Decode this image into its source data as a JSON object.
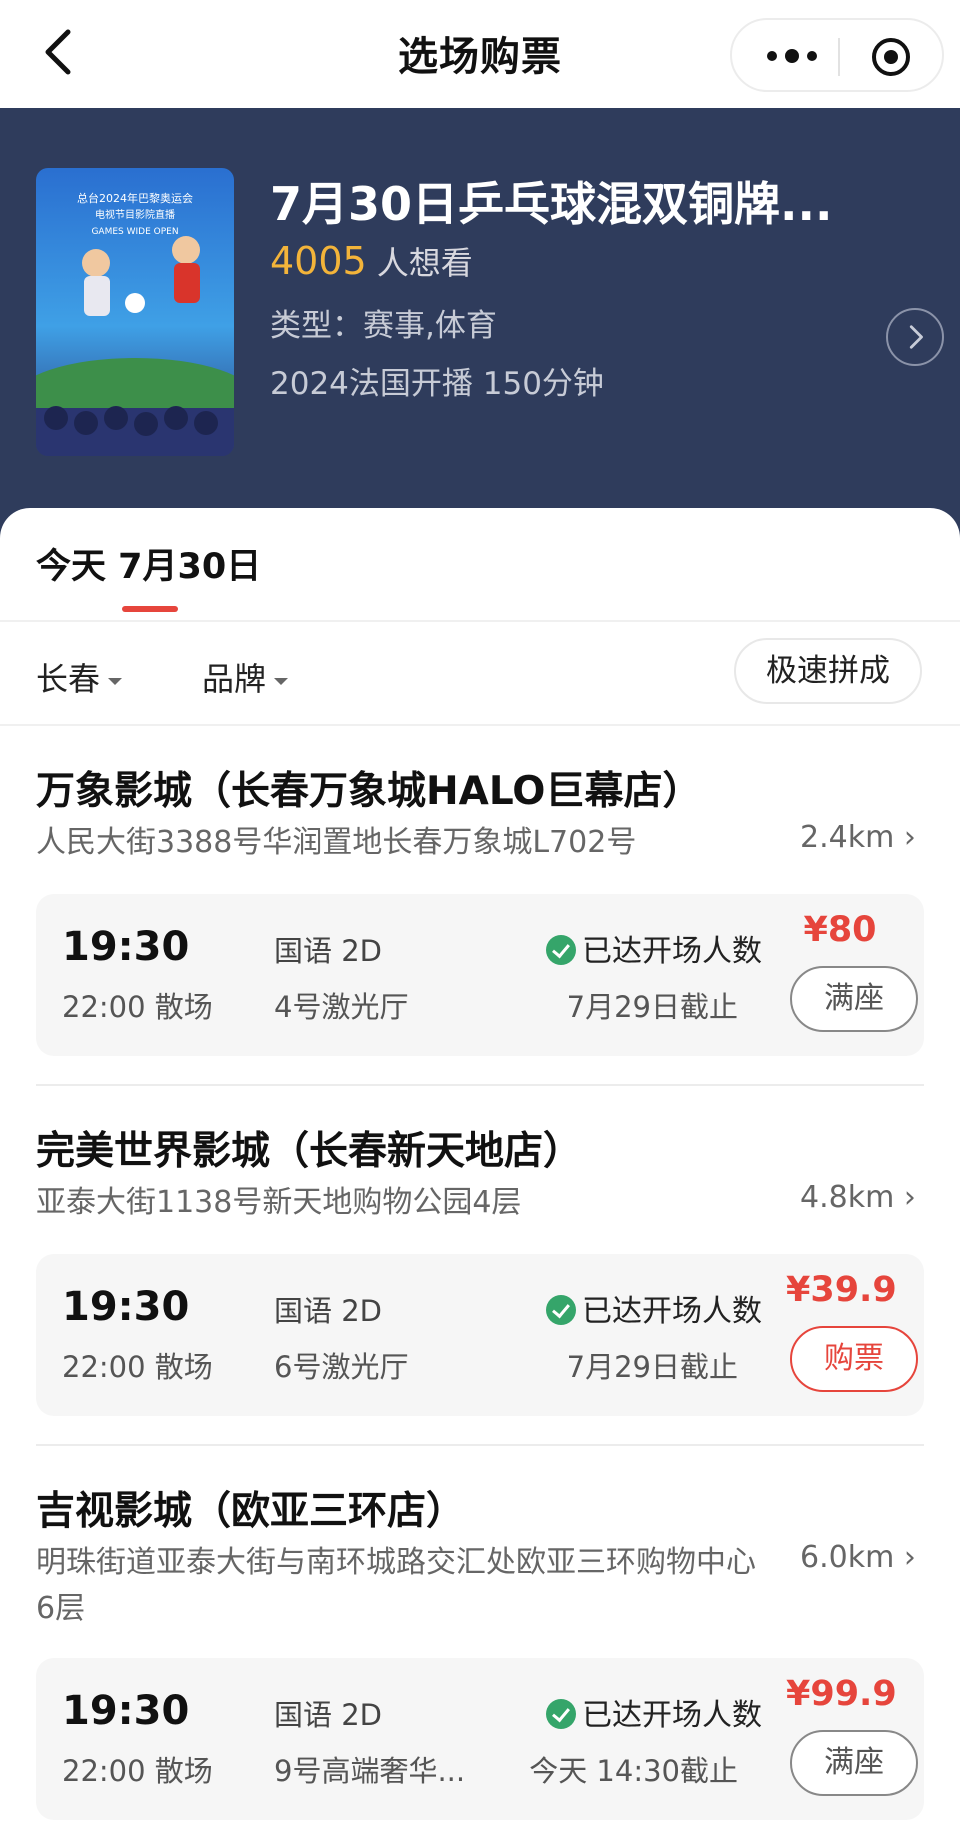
{
  "nav": {
    "title": "选场购票"
  },
  "movie": {
    "title": "7月30日乒乓球混双铜牌...",
    "want_count": "4005",
    "want_label": "人想看",
    "genre": "类型：赛事,体育",
    "meta": "2024法国开播 150分钟",
    "poster_lines": [
      "总台2024年巴黎奥运会",
      "电视节目影院直播",
      "GAMES WIDE OPEN"
    ]
  },
  "date_tab": "今天 7月30日",
  "filters": {
    "city": "长春",
    "brand": "品牌",
    "fast": "极速拼成"
  },
  "cinemas": [
    {
      "name": "万象影城（长春万象城HALO巨幕店）",
      "address": "人民大街3388号华润置地长春万象城L702号",
      "distance": "2.4km",
      "show": {
        "start": "19:30",
        "end": "22:00 散场",
        "lang": "国语 2D",
        "hall": "4号激光厅",
        "status": "已达开场人数",
        "deadline": "7月29日截止",
        "price": "¥80",
        "action": "满座"
      }
    },
    {
      "name": "完美世界影城（长春新天地店）",
      "address": "亚泰大街1138号新天地购物公园4层",
      "distance": "4.8km",
      "show": {
        "start": "19:30",
        "end": "22:00 散场",
        "lang": "国语 2D",
        "hall": "6号激光厅",
        "status": "已达开场人数",
        "deadline": "7月29日截止",
        "price": "¥39.9",
        "action": "购票"
      }
    },
    {
      "name": "吉视影城（欧亚三环店）",
      "address": "明珠街道亚泰大街与南环城路交汇处欧亚三环购物中心6层",
      "distance": "6.0km",
      "show": {
        "start": "19:30",
        "end": "22:00 散场",
        "lang": "国语 2D",
        "hall": "9号高端奢华...",
        "status": "已达开场人数",
        "deadline": "今天 14:30截止",
        "price": "¥99.9",
        "action": "满座"
      }
    }
  ],
  "colors": {
    "hero_bg": "#2f3c5c",
    "accent": "#e6453c",
    "want_count": "#f3b43a",
    "check": "#35a56a"
  }
}
